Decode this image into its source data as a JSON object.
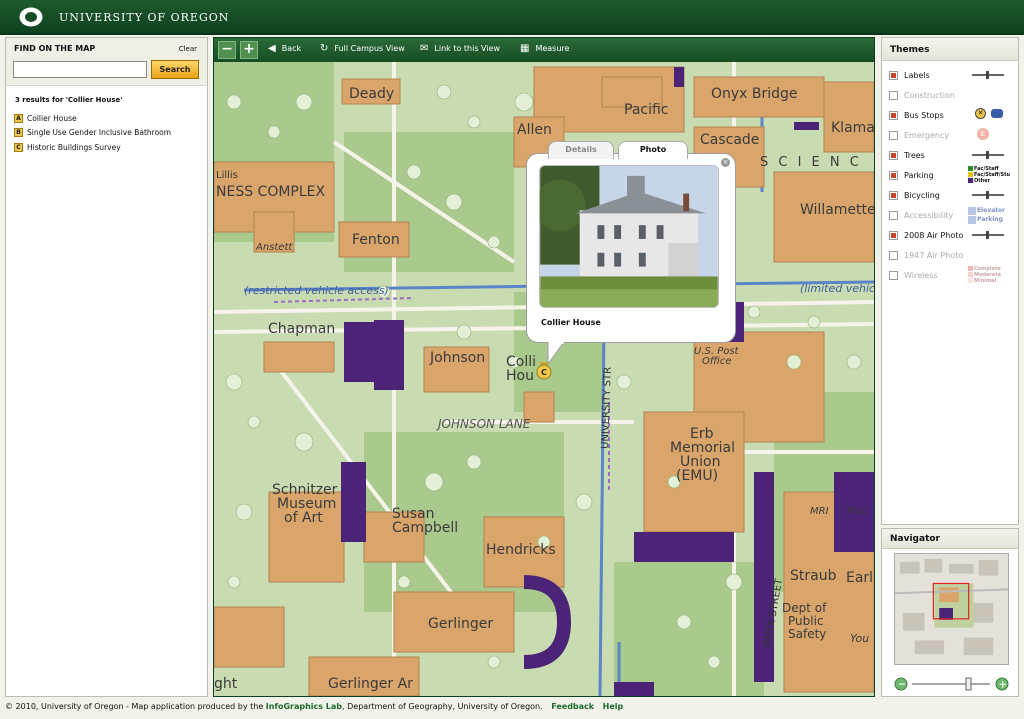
{
  "header": {
    "title": "UNIVERSITY OF OREGON",
    "logo": "O"
  },
  "find": {
    "title": "FIND ON THE MAP",
    "clear_label": "Clear",
    "search_value": "",
    "search_button": "Search",
    "result_count": "3 results for 'Collier House'",
    "results": [
      {
        "badge": "A",
        "label": "Collier House"
      },
      {
        "badge": "B",
        "label": "Single Use Gender Inclusive Bathroom"
      },
      {
        "badge": "C",
        "label": "Historic Buildings Survey"
      }
    ]
  },
  "toolbar": {
    "zoom_out": "−",
    "zoom_in": "+",
    "back": "Back",
    "full_campus": "Full Campus View",
    "link": "Link to this View",
    "measure": "Measure"
  },
  "map": {
    "labels": {
      "deady": "Deady",
      "pacific": "Pacific",
      "onyx_bridge": "Onyx Bridge",
      "klamath": "Klama",
      "allen": "Allen",
      "cascade": "Cascade",
      "willamette": "Willamette",
      "lillis": "Lillis",
      "business_complex": "NESS COMPLEX",
      "fenton": "Fenton",
      "anstett": "Anstett",
      "restricted": "(restricted vehicle access)",
      "limited": "(limited vehic",
      "chapman": "Chapman",
      "johnson": "Johnson",
      "collier_1": "Colli",
      "collier_2": "Hou",
      "us_post_1": "U.S. Post",
      "us_post_2": "Office",
      "johnson_lane": "JOHNSON LANE",
      "university_street": "UNIVERSITY STR",
      "erb_1": "Erb",
      "erb_2": "Memorial",
      "erb_3": "Union",
      "erb_4": "(EMU)",
      "schnitzer_1": "Schnitzer",
      "schnitzer_2": "Museum",
      "schnitzer_3": "of Art",
      "susan_1": "Susan",
      "susan_2": "Campbell",
      "hendricks": "Hendricks",
      "mri": "MRI",
      "mcc": "McC",
      "straub": "Straub",
      "earl": "Earl",
      "onyx_street": "ONYX STREET",
      "dps_1": "Dept of",
      "dps_2": "Public",
      "dps_3": "Safety",
      "young": "You",
      "gerlinger": "Gerlinger",
      "gerlinger_annex": "Gerlinger Ar",
      "ght": "ght",
      "scienc": "S C I E N C"
    },
    "marker_badge": "C"
  },
  "popup": {
    "tab_details": "Details",
    "tab_photo": "Photo",
    "caption": "Collier House",
    "close": "×"
  },
  "themes": {
    "title": "Themes",
    "items": [
      {
        "label": "Labels",
        "checked": true
      },
      {
        "label": "Construction",
        "checked": false
      },
      {
        "label": "Bus Stops",
        "checked": true
      },
      {
        "label": "Emergency",
        "checked": false
      },
      {
        "label": "Trees",
        "checked": true
      },
      {
        "label": "Parking",
        "checked": true
      },
      {
        "label": "Bicycling",
        "checked": true
      },
      {
        "label": "Accessibility",
        "checked": false
      },
      {
        "label": "2008 Air Photo",
        "checked": true
      },
      {
        "label": "1947 Air Photo",
        "checked": false
      },
      {
        "label": "Wireless",
        "checked": false
      }
    ],
    "parking_legend": [
      "Fac/Staff",
      "Fac/Staff/Stu",
      "Other"
    ],
    "access_legend": [
      "Elevator",
      "Parking"
    ],
    "wireless_legend": [
      "Complete",
      "Moderate",
      "Minimal"
    ]
  },
  "navigator": {
    "title": "Navigator",
    "zoom_out": "−",
    "zoom_in": "+"
  },
  "footer": {
    "prefix": "© 2010, University of Oregon - Map application produced by the",
    "lab": "InfoGraphics Lab",
    "suffix": ", Department of Geography, University of Oregon.",
    "feedback": "Feedback",
    "help": "Help"
  },
  "colors": {
    "uo_green": "#174d24",
    "building": "#d9a56b",
    "parking_purple": "#4b2478",
    "path_blue": "#5c84c8"
  }
}
